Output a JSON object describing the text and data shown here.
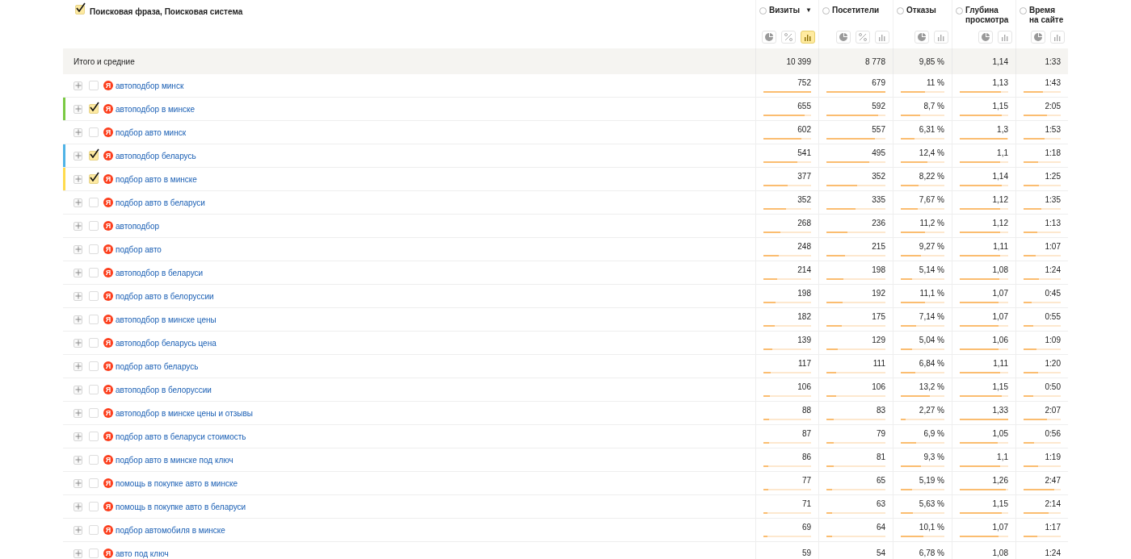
{
  "dimension_header": {
    "label": "Поисковая фраза, Поисковая система",
    "checked": true
  },
  "columns": [
    {
      "label": "Визиты",
      "sort": "▼",
      "buttons": [
        {
          "kind": "pie",
          "selected": false
        },
        {
          "kind": "percent",
          "selected": false
        },
        {
          "kind": "bars",
          "selected": true
        }
      ]
    },
    {
      "label": "Посетители",
      "buttons": [
        {
          "kind": "pie",
          "selected": false
        },
        {
          "kind": "percent",
          "selected": false
        },
        {
          "kind": "bars",
          "selected": false
        }
      ]
    },
    {
      "label": "Отказы",
      "buttons": [
        {
          "kind": "pie",
          "selected": false
        },
        {
          "kind": "bars",
          "selected": false
        }
      ]
    },
    {
      "label": "Глубина просмотра",
      "buttons": [
        {
          "kind": "pie",
          "selected": false
        },
        {
          "kind": "bars",
          "selected": false
        }
      ]
    },
    {
      "label": "Время на сайте",
      "buttons": [
        {
          "kind": "pie",
          "selected": false
        },
        {
          "kind": "bars",
          "selected": false
        }
      ]
    }
  ],
  "totals": {
    "label": "Итого и средние",
    "values": [
      "10 399",
      "8 778",
      "9,85 %",
      "1,14",
      "1:33"
    ]
  },
  "rows": [
    {
      "phrase": "автоподбор минск",
      "engine": "Я",
      "checked": false,
      "cells": [
        {
          "text": "752",
          "level": 1
        },
        {
          "text": "679",
          "level": 1
        },
        {
          "text": "11 %",
          "level": 0.55
        },
        {
          "text": "1,13",
          "level": 0.85
        },
        {
          "text": "1:43",
          "level": 0.52
        }
      ]
    },
    {
      "phrase": "автоподбор в минске",
      "engine": "Я",
      "checked": true,
      "color": "#7ac943",
      "cells": [
        {
          "text": "655",
          "level": 0.87
        },
        {
          "text": "592",
          "level": 0.87
        },
        {
          "text": "8,7 %",
          "level": 0.44
        },
        {
          "text": "1,15",
          "level": 0.86
        },
        {
          "text": "2:05",
          "level": 0.62
        }
      ]
    },
    {
      "phrase": "подбор авто минск",
      "engine": "Я",
      "checked": false,
      "cells": [
        {
          "text": "602",
          "level": 0.8
        },
        {
          "text": "557",
          "level": 0.82
        },
        {
          "text": "6,31 %",
          "level": 0.32
        },
        {
          "text": "1,3",
          "level": 0.98
        },
        {
          "text": "1:53",
          "level": 0.56
        }
      ]
    },
    {
      "phrase": "автоподбор беларусь",
      "engine": "Я",
      "checked": true,
      "color": "#4fb3e6",
      "cells": [
        {
          "text": "541",
          "level": 0.72
        },
        {
          "text": "495",
          "level": 0.73
        },
        {
          "text": "12,4 %",
          "level": 0.62
        },
        {
          "text": "1,1",
          "level": 0.83
        },
        {
          "text": "1:18",
          "level": 0.39
        }
      ]
    },
    {
      "phrase": "подбор авто в минске",
      "engine": "Я",
      "checked": true,
      "color": "#ffdb4d",
      "cells": [
        {
          "text": "377",
          "level": 0.5
        },
        {
          "text": "352",
          "level": 0.52
        },
        {
          "text": "8,22 %",
          "level": 0.41
        },
        {
          "text": "1,14",
          "level": 0.86
        },
        {
          "text": "1:25",
          "level": 0.42
        }
      ]
    },
    {
      "phrase": "подбор авто в беларуси",
      "engine": "Я",
      "checked": false,
      "cells": [
        {
          "text": "352",
          "level": 0.47
        },
        {
          "text": "335",
          "level": 0.49
        },
        {
          "text": "7,67 %",
          "level": 0.38
        },
        {
          "text": "1,12",
          "level": 0.84
        },
        {
          "text": "1:35",
          "level": 0.47
        }
      ]
    },
    {
      "phrase": "автоподбор",
      "engine": "Я",
      "checked": false,
      "cells": [
        {
          "text": "268",
          "level": 0.36
        },
        {
          "text": "236",
          "level": 0.35
        },
        {
          "text": "11,2 %",
          "level": 0.56
        },
        {
          "text": "1,12",
          "level": 0.84
        },
        {
          "text": "1:13",
          "level": 0.36
        }
      ]
    },
    {
      "phrase": "подбор авто",
      "engine": "Я",
      "checked": false,
      "cells": [
        {
          "text": "248",
          "level": 0.33
        },
        {
          "text": "215",
          "level": 0.32
        },
        {
          "text": "9,27 %",
          "level": 0.46
        },
        {
          "text": "1,11",
          "level": 0.83
        },
        {
          "text": "1:07",
          "level": 0.33
        }
      ]
    },
    {
      "phrase": "автоподбор в беларуси",
      "engine": "Я",
      "checked": false,
      "cells": [
        {
          "text": "214",
          "level": 0.28
        },
        {
          "text": "198",
          "level": 0.29
        },
        {
          "text": "5,14 %",
          "level": 0.26
        },
        {
          "text": "1,08",
          "level": 0.81
        },
        {
          "text": "1:24",
          "level": 0.42
        }
      ]
    },
    {
      "phrase": "подбор авто в белоруссии",
      "engine": "Я",
      "checked": false,
      "cells": [
        {
          "text": "198",
          "level": 0.26
        },
        {
          "text": "192",
          "level": 0.28
        },
        {
          "text": "11,1 %",
          "level": 0.56
        },
        {
          "text": "1,07",
          "level": 0.8
        },
        {
          "text": "0:45",
          "level": 0.22
        }
      ]
    },
    {
      "phrase": "автоподбор в минске цены",
      "engine": "Я",
      "checked": false,
      "cells": [
        {
          "text": "182",
          "level": 0.24
        },
        {
          "text": "175",
          "level": 0.26
        },
        {
          "text": "7,14 %",
          "level": 0.36
        },
        {
          "text": "1,07",
          "level": 0.8
        },
        {
          "text": "0:55",
          "level": 0.27
        }
      ]
    },
    {
      "phrase": "автоподбор беларусь цена",
      "engine": "Я",
      "checked": false,
      "cells": [
        {
          "text": "139",
          "level": 0.18
        },
        {
          "text": "129",
          "level": 0.19
        },
        {
          "text": "5,04 %",
          "level": 0.25
        },
        {
          "text": "1,06",
          "level": 0.8
        },
        {
          "text": "1:09",
          "level": 0.34
        }
      ]
    },
    {
      "phrase": "подбор авто беларусь",
      "engine": "Я",
      "checked": false,
      "cells": [
        {
          "text": "117",
          "level": 0.16
        },
        {
          "text": "111",
          "level": 0.16
        },
        {
          "text": "6,84 %",
          "level": 0.34
        },
        {
          "text": "1,11",
          "level": 0.83
        },
        {
          "text": "1:20",
          "level": 0.4
        }
      ]
    },
    {
      "phrase": "автоподбор в белоруссии",
      "engine": "Я",
      "checked": false,
      "cells": [
        {
          "text": "106",
          "level": 0.14
        },
        {
          "text": "106",
          "level": 0.16
        },
        {
          "text": "13,2 %",
          "level": 0.66
        },
        {
          "text": "1,15",
          "level": 0.86
        },
        {
          "text": "0:50",
          "level": 0.25
        }
      ]
    },
    {
      "phrase": "автоподбор в минске цены и отзывы",
      "engine": "Я",
      "checked": false,
      "cells": [
        {
          "text": "88",
          "level": 0.12
        },
        {
          "text": "83",
          "level": 0.12
        },
        {
          "text": "2,27 %",
          "level": 0.11
        },
        {
          "text": "1,33",
          "level": 1
        },
        {
          "text": "2:07",
          "level": 0.63
        }
      ]
    },
    {
      "phrase": "подбор авто в беларуси стоимость",
      "engine": "Я",
      "checked": false,
      "cells": [
        {
          "text": "87",
          "level": 0.12
        },
        {
          "text": "79",
          "level": 0.12
        },
        {
          "text": "6,9 %",
          "level": 0.35
        },
        {
          "text": "1,05",
          "level": 0.79
        },
        {
          "text": "0:56",
          "level": 0.28
        }
      ]
    },
    {
      "phrase": "подбор авто в минске под ключ",
      "engine": "Я",
      "checked": false,
      "cells": [
        {
          "text": "86",
          "level": 0.11
        },
        {
          "text": "81",
          "level": 0.12
        },
        {
          "text": "9,3 %",
          "level": 0.47
        },
        {
          "text": "1,1",
          "level": 0.83
        },
        {
          "text": "1:19",
          "level": 0.4
        }
      ]
    },
    {
      "phrase": "помощь в покупке авто в минске",
      "engine": "Я",
      "checked": false,
      "cells": [
        {
          "text": "77",
          "level": 0.1
        },
        {
          "text": "65",
          "level": 0.1
        },
        {
          "text": "5,19 %",
          "level": 0.26
        },
        {
          "text": "1,26",
          "level": 0.95
        },
        {
          "text": "2:47",
          "level": 0.83
        }
      ]
    },
    {
      "phrase": "помощь в покупке авто в беларуси",
      "engine": "Я",
      "checked": false,
      "cells": [
        {
          "text": "71",
          "level": 0.09
        },
        {
          "text": "63",
          "level": 0.09
        },
        {
          "text": "5,63 %",
          "level": 0.28
        },
        {
          "text": "1,15",
          "level": 0.86
        },
        {
          "text": "2:14",
          "level": 0.67
        }
      ]
    },
    {
      "phrase": "подбор автомобиля в минске",
      "engine": "Я",
      "checked": false,
      "cells": [
        {
          "text": "69",
          "level": 0.09
        },
        {
          "text": "64",
          "level": 0.09
        },
        {
          "text": "10,1 %",
          "level": 0.51
        },
        {
          "text": "1,07",
          "level": 0.8
        },
        {
          "text": "1:17",
          "level": 0.38
        }
      ]
    },
    {
      "phrase": "авто под ключ",
      "engine": "Я",
      "checked": false,
      "cells": [
        {
          "text": "59"
        },
        {
          "text": "54"
        },
        {
          "text": "6,78 %"
        },
        {
          "text": "1,08"
        },
        {
          "text": "1:24"
        }
      ]
    }
  ]
}
